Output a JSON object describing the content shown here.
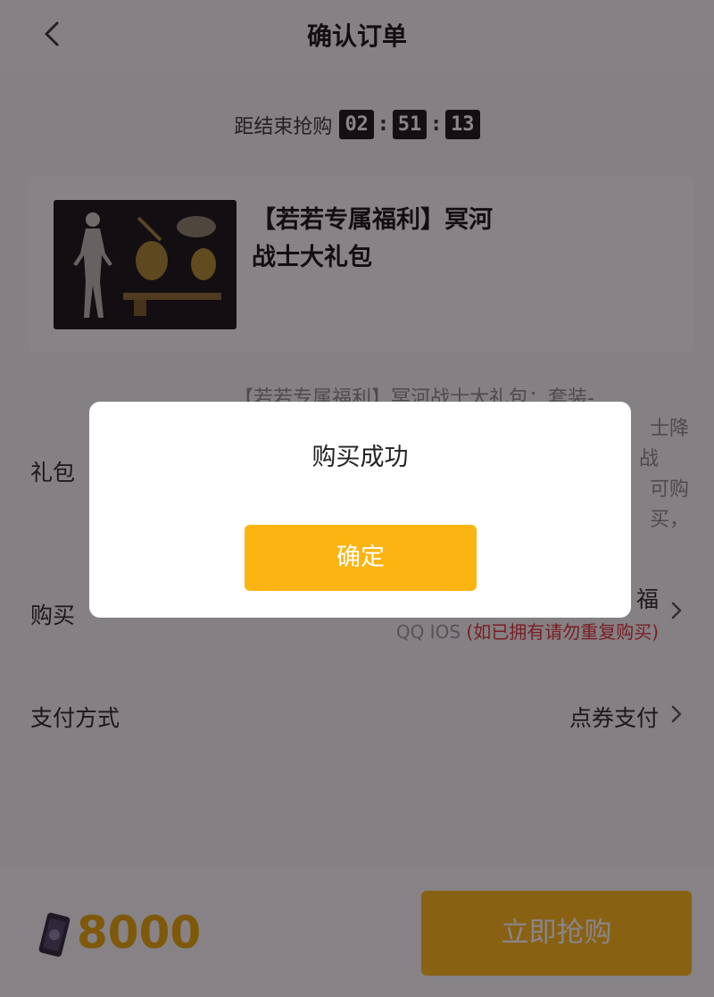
{
  "header": {
    "title": "确认订单",
    "back_icon": "chevron-left-icon"
  },
  "countdown": {
    "label": "距结束抢购",
    "hours": "02",
    "minutes": "51",
    "seconds": "13"
  },
  "product": {
    "name_line1": "【若若专属福利】冥河",
    "name_line2": "战士大礼包"
  },
  "details": {
    "description_lines": [
      "【若若专属福利】冥河战士大礼包：套装-",
      "士降",
      "战",
      "可购",
      "买，"
    ],
    "gift_label": "礼包",
    "purchase_label": "购买",
    "purchase_value": "福",
    "account_platform": "QQ IOS",
    "account_warning": "(如已拥有请勿重复购买)",
    "payment_label": "支付方式",
    "payment_value": "点券支付"
  },
  "bottom": {
    "coupon_icon": "coupon-icon",
    "price": "8000",
    "buy_label": "立即抢购"
  },
  "dialog": {
    "message": "购买成功",
    "ok_label": "确定"
  },
  "colors": {
    "accent": "#fcb412",
    "price": "#e8a700",
    "warning": "#e03030",
    "overlay": "rgba(20,12,20,0.5)"
  }
}
